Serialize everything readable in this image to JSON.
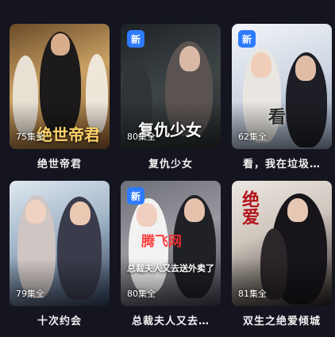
{
  "dramas": [
    {
      "title": "绝世帝君",
      "episodes": "75集全",
      "poster_text": "绝世帝君",
      "is_new": false,
      "new_label": "",
      "colors": [
        "#8a5a2e",
        "#d9b77a"
      ]
    },
    {
      "title": "复仇少女",
      "episodes": "80集全",
      "poster_text": "复仇少女",
      "is_new": true,
      "new_label": "新",
      "colors": [
        "#2b3135",
        "#6c6a6a"
      ]
    },
    {
      "title": "看，我在垃圾…",
      "episodes": "62集全",
      "poster_text": "看",
      "is_new": true,
      "new_label": "新",
      "colors": [
        "#d6dce6",
        "#8796aa"
      ]
    },
    {
      "title": "十次约会",
      "episodes": "79集全",
      "poster_text": "",
      "is_new": false,
      "new_label": "",
      "colors": [
        "#b7c7d6",
        "#33405a"
      ]
    },
    {
      "title": "总裁夫人又去…",
      "episodes": "80集全",
      "poster_text": "总裁夫人又去送外卖了",
      "is_new": true,
      "new_label": "新",
      "colors": [
        "#4c4f5a",
        "#a39fa4"
      ]
    },
    {
      "title": "双生之绝爱倾城",
      "episodes": "81集全",
      "poster_text": "绝爱",
      "is_new": false,
      "new_label": "",
      "colors": [
        "#e9e3dc",
        "#2a2321"
      ]
    }
  ],
  "watermark": "腾飞网"
}
